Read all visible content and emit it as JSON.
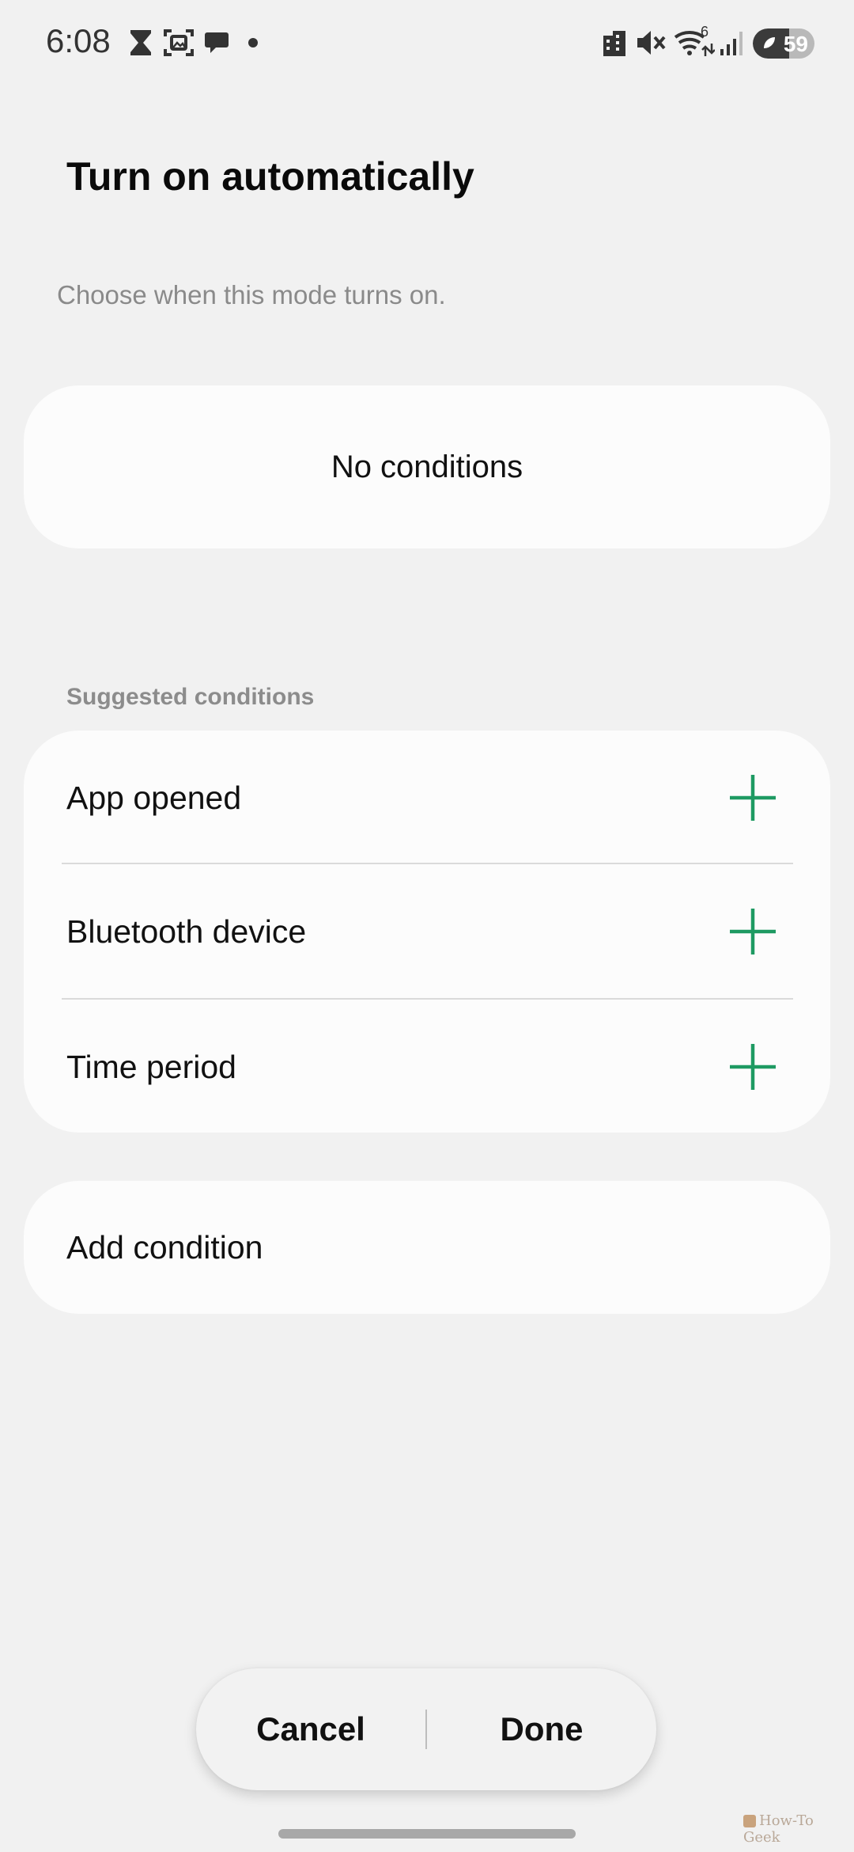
{
  "status_bar": {
    "time": "6:08",
    "notification_icons": [
      "hourglass-icon",
      "screenshot-icon",
      "chat-bubble-icon"
    ],
    "system_icons": [
      "building-icon",
      "mute-icon",
      "wifi-icon",
      "signal-icon"
    ],
    "wifi_label": "6",
    "battery_percent": "59",
    "battery_level": 0.59
  },
  "header": {
    "title": "Turn on automatically",
    "subtitle": "Choose when this mode turns on."
  },
  "current_conditions": {
    "empty_text": "No conditions"
  },
  "suggested": {
    "label": "Suggested conditions",
    "items": [
      {
        "label": "App opened"
      },
      {
        "label": "Bluetooth device"
      },
      {
        "label": "Time period"
      }
    ]
  },
  "add_condition": {
    "label": "Add condition"
  },
  "actions": {
    "cancel": "Cancel",
    "done": "Done"
  },
  "watermark": "How-To Geek",
  "colors": {
    "background": "#f1f1f1",
    "card": "#fcfcfc",
    "accent_plus": "#1e9a62",
    "subtitle_gray": "#8a8a8a"
  }
}
